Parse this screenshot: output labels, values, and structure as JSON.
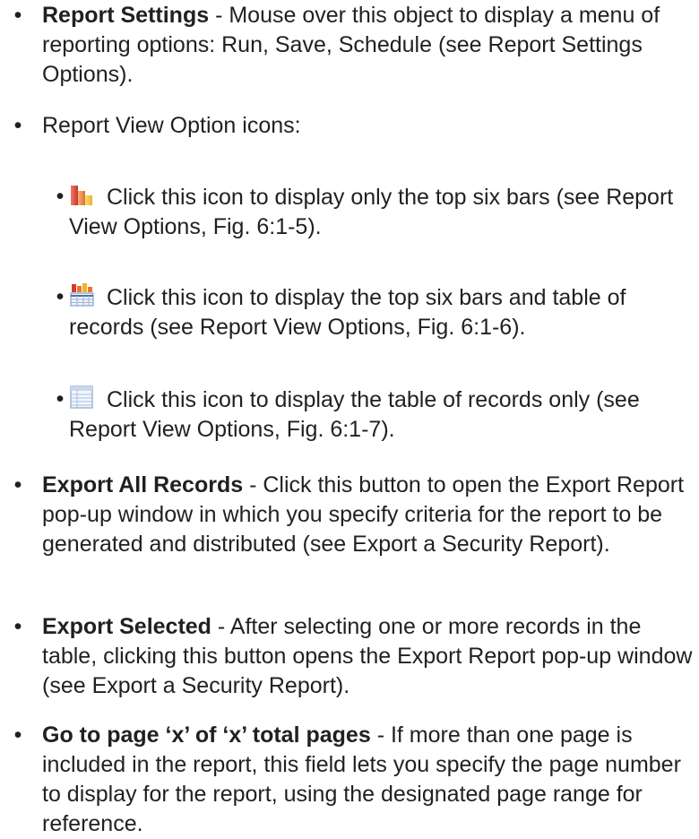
{
  "bullet_char": "•",
  "items": [
    {
      "term": "Report Settings",
      "text": " - Mouse over this object to display a menu of reporting options: Run, Save, Schedule (see Report Settings Options)."
    },
    {
      "text": "Report View Option icons:"
    },
    {
      "icon": "bar-chart-icon",
      "text": "Click this icon to display only the top six bars (see Report View Options, Fig. 6:1-5)."
    },
    {
      "icon": "bar-chart-table-icon",
      "text": "Click this icon to display the top six bars and table of records (see Report View Options, Fig. 6:1-6)."
    },
    {
      "icon": "table-icon",
      "text": "Click this icon to display the table of records only (see Report View Options, Fig. 6:1-7)."
    },
    {
      "term": "Export All Records",
      "text": " - Click this button to open the Export Report pop-up window in which you specify criteria for the report to be generated and distributed (see Export a Security Report)."
    },
    {
      "term": "Export Selected",
      "text": " - After selecting one or more records in the table, clicking this button opens the Export Report pop-up window (see Export a Security Report)."
    },
    {
      "term": "Go to page ‘x’ of ‘x’ total pages",
      "text": " - If more than one page is included in the report, this field lets you specify the page number to display for the report, using the designated page range for reference."
    }
  ]
}
